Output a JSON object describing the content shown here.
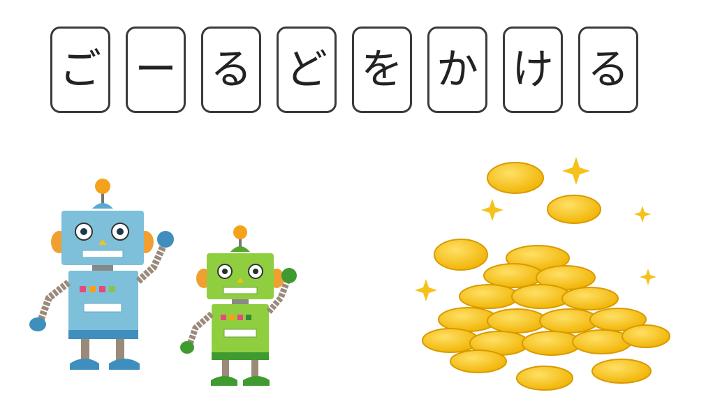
{
  "title_cards": [
    "ご",
    "ー",
    "る",
    "ど",
    "を",
    "か",
    "け",
    "る"
  ],
  "illustrations": {
    "robots": {
      "icon": "robots-icon",
      "left_robot_color": "#7ec0da",
      "right_robot_color": "#8fcf3f"
    },
    "coins": {
      "icon": "gold-coins-icon",
      "coin_color": "#f4c21a"
    }
  }
}
